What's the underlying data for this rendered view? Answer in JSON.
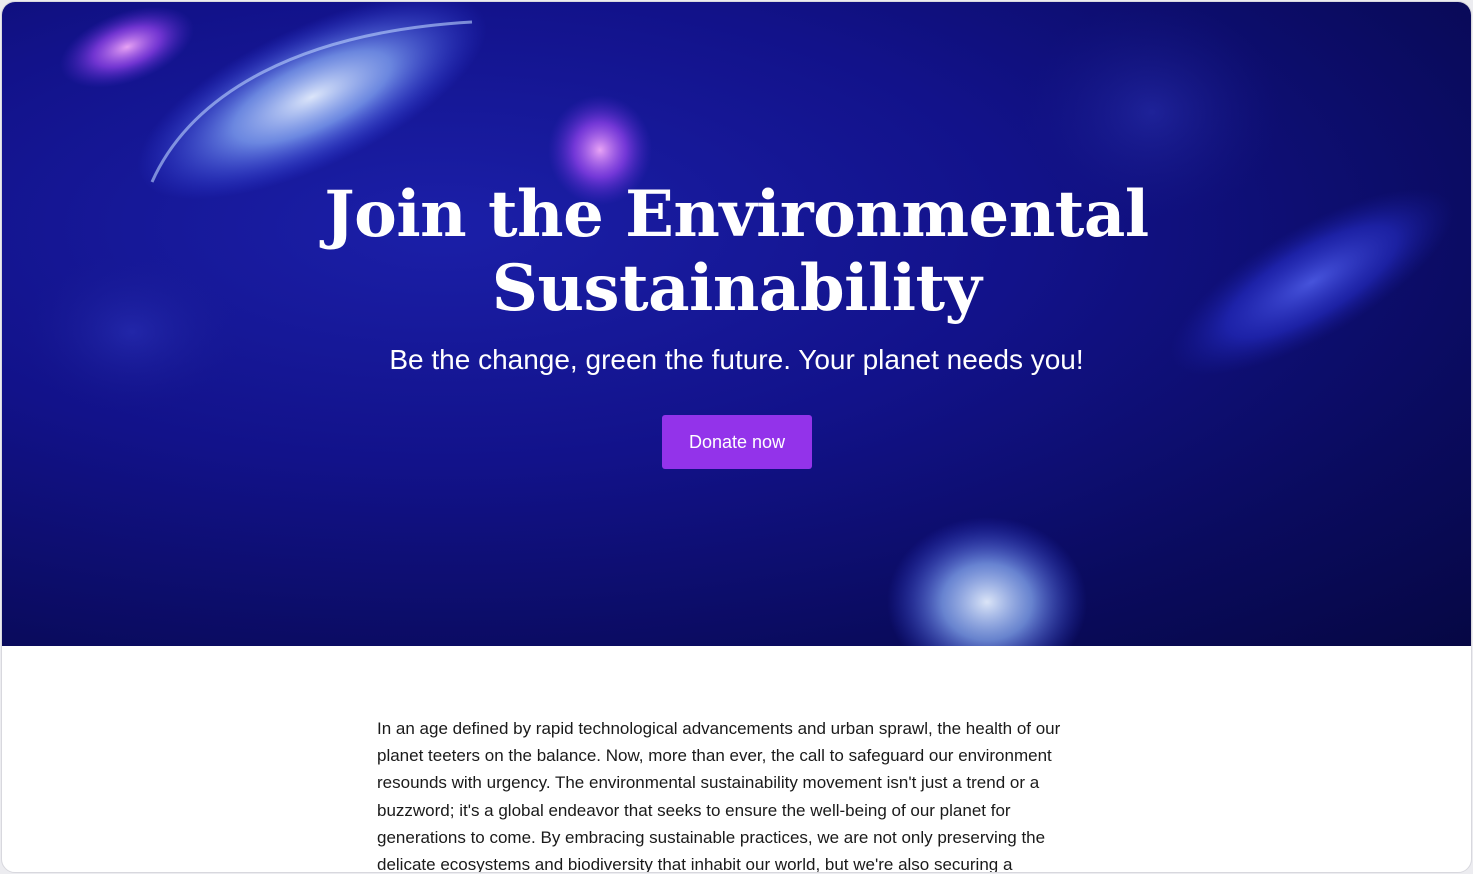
{
  "hero": {
    "title_line1": "Join the Environmental",
    "title_line2": "Sustainability",
    "subtitle": "Be the change, green the future. Your planet needs you!",
    "donate_label": "Donate now",
    "background": "jellyfish-underwater-image",
    "colors": {
      "background": "#12128a",
      "button": "#9333ea",
      "text": "#ffffff"
    }
  },
  "article": {
    "body": "In an age defined by rapid technological advancements and urban sprawl, the health of our planet teeters on the balance. Now, more than ever, the call to safeguard our environment resounds with urgency. The environmental sustainability movement isn't just a trend or a buzzword; it's a global endeavor that seeks to ensure the well-being of our planet for generations to come. By embracing sustainable practices, we are not only preserving the delicate ecosystems and biodiversity that inhabit our world, but we're also securing a"
  }
}
